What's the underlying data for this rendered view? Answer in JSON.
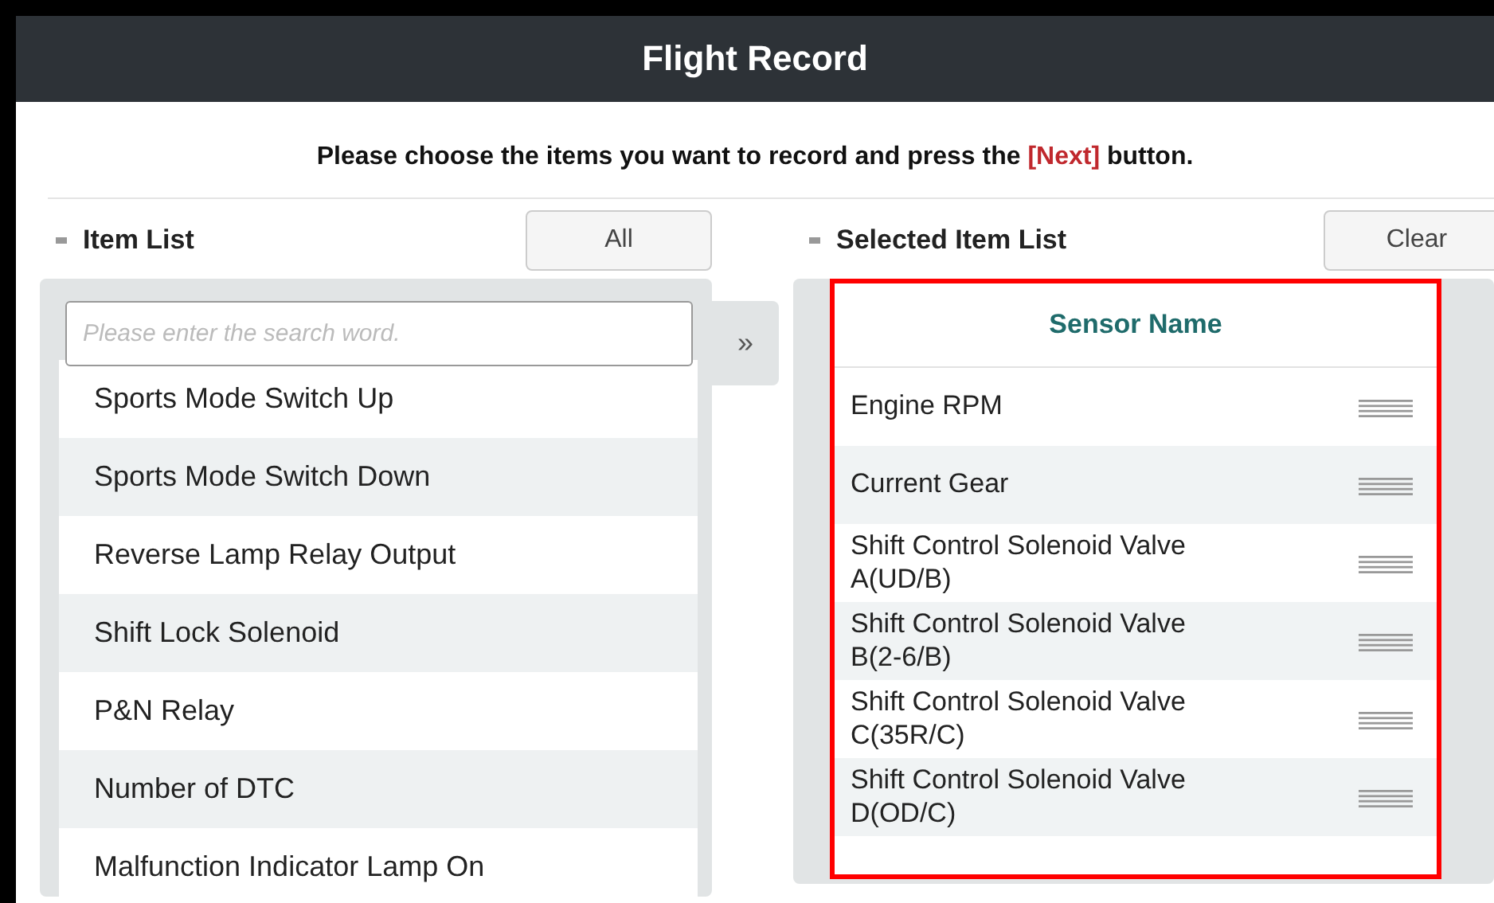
{
  "window": {
    "title": "Flight Record"
  },
  "instruction": "Please choose the items you want to record and press the **[Next]** button.",
  "item_list": {
    "title": "Item List",
    "all_button": "All",
    "search": {
      "placeholder": "Please enter the search word."
    },
    "items": [
      "Sports Mode Switch Up",
      "Sports Mode Switch Down",
      "Reverse Lamp Relay Output",
      "Shift Lock Solenoid",
      "P&N Relay",
      "Number of DTC",
      "Malfunction Indicator Lamp On"
    ]
  },
  "move_button": "»",
  "selected_list": {
    "title": "Selected Item List",
    "clear_button": "Clear",
    "highlighted": true,
    "column": "Sensor Name",
    "items": [
      "Engine RPM",
      "Current Gear",
      "Shift Control Solenoid Valve A(UD/B)",
      "Shift Control Solenoid Valve B(2-6/B)",
      "Shift Control Solenoid Valve C(35R/C)",
      "Shift Control Solenoid Valve D(OD/C)"
    ]
  }
}
